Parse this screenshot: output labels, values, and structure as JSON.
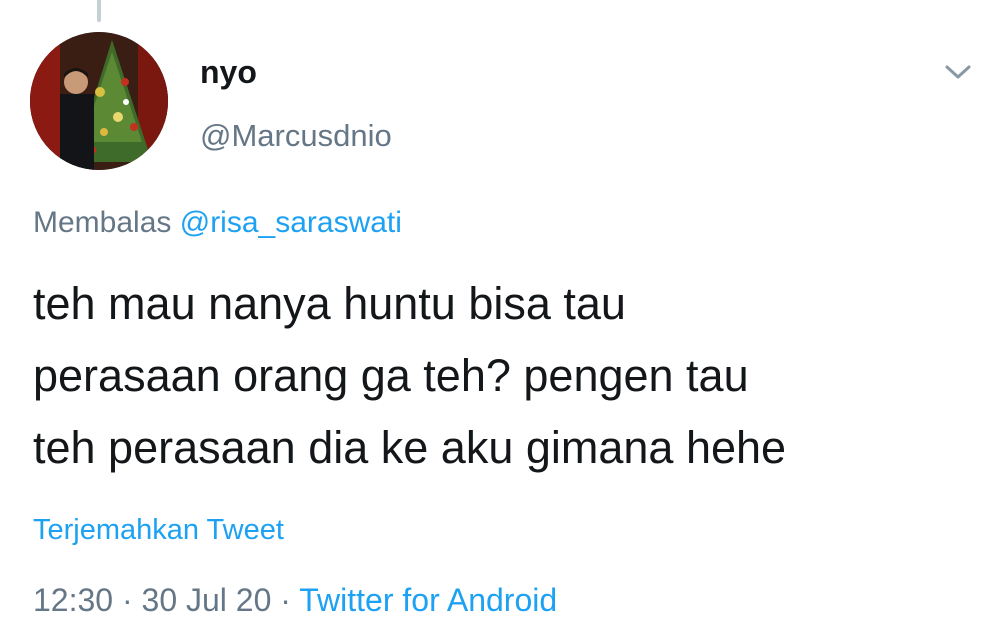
{
  "tweet": {
    "user": {
      "display_name": "nyo",
      "handle": "@Marcusdnio"
    },
    "reply_prefix": "Membalas",
    "reply_to": "@risa_saraswati",
    "text_lines": [
      "teh mau nanya huntu bisa tau",
      "perasaan orang ga teh? pengen tau",
      "teh perasaan dia ke aku gimana hehe"
    ],
    "translate_label": "Terjemahkan Tweet",
    "time": "12:30",
    "separator": "·",
    "date": "30 Jul 20",
    "source": "Twitter for Android",
    "menu_icon": "chevron-down-icon"
  },
  "colors": {
    "text_primary": "#14171a",
    "text_secondary": "#657786",
    "link": "#1da1f2"
  }
}
